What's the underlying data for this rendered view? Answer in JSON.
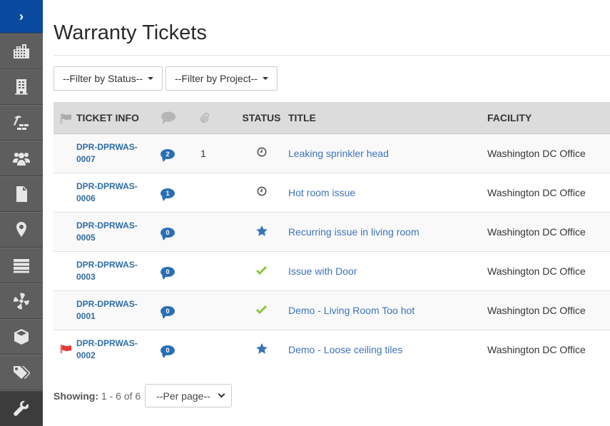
{
  "sidebar": {
    "toggle_glyph": "›",
    "items": [
      {
        "name": "buildings-icon",
        "active": false
      },
      {
        "name": "building-icon",
        "active": false
      },
      {
        "name": "construction-icon",
        "active": false
      },
      {
        "name": "users-icon",
        "active": false
      },
      {
        "name": "document-icon",
        "active": false
      },
      {
        "name": "location-pin-icon",
        "active": false
      },
      {
        "name": "server-icon",
        "active": false
      },
      {
        "name": "fan-icon",
        "active": false
      },
      {
        "name": "cube-icon",
        "active": false
      },
      {
        "name": "tags-icon",
        "active": false
      },
      {
        "name": "wrench-icon",
        "active": true
      }
    ]
  },
  "page": {
    "title": "Warranty Tickets"
  },
  "filters": {
    "status_label": "--Filter by Status--",
    "project_label": "--Filter by Project--"
  },
  "table": {
    "headers": {
      "flag": "flag-icon",
      "ticket_info": "TICKET INFO",
      "comments": "comment-icon",
      "attachments": "paperclip-icon",
      "status": "STATUS",
      "title": "TITLE",
      "facility": "FACILITY"
    },
    "rows": [
      {
        "flagged": false,
        "ticket_id": "DPR-DPRWAS-0007",
        "comments": "2",
        "attachments": "1",
        "status": "pending",
        "title": "Leaking sprinkler head",
        "facility": "Washington DC Office"
      },
      {
        "flagged": false,
        "ticket_id": "DPR-DPRWAS-0006",
        "comments": "1",
        "attachments": "",
        "status": "pending",
        "title": "Hot room issue",
        "facility": "Washington DC Office"
      },
      {
        "flagged": false,
        "ticket_id": "DPR-DPRWAS-0005",
        "comments": "0",
        "attachments": "",
        "status": "new",
        "title": "Recurring issue in living room",
        "facility": "Washington DC Office"
      },
      {
        "flagged": false,
        "ticket_id": "DPR-DPRWAS-0003",
        "comments": "0",
        "attachments": "",
        "status": "completed",
        "title": "Issue with Door",
        "facility": "Washington DC Office"
      },
      {
        "flagged": false,
        "ticket_id": "DPR-DPRWAS-0001",
        "comments": "0",
        "attachments": "",
        "status": "completed",
        "title": "Demo - Living Room Too hot",
        "facility": "Washington DC Office"
      },
      {
        "flagged": true,
        "ticket_id": "DPR-DPRWAS-0002",
        "comments": "0",
        "attachments": "",
        "status": "new",
        "title": "Demo - Loose ceiling tiles",
        "facility": "Washington DC Office"
      }
    ]
  },
  "footer": {
    "showing_label": "Showing:",
    "showing_value": "1 - 6 of 6",
    "per_page_label": "--Per page--"
  },
  "colors": {
    "sidebar_bg": "#5e5e5e",
    "sidebar_toggle": "#0a4a9e",
    "link": "#3b73b9",
    "bubble": "#2a6fb4",
    "check": "#8cc63f",
    "star": "#3b73b9",
    "flag": "#e53935"
  }
}
